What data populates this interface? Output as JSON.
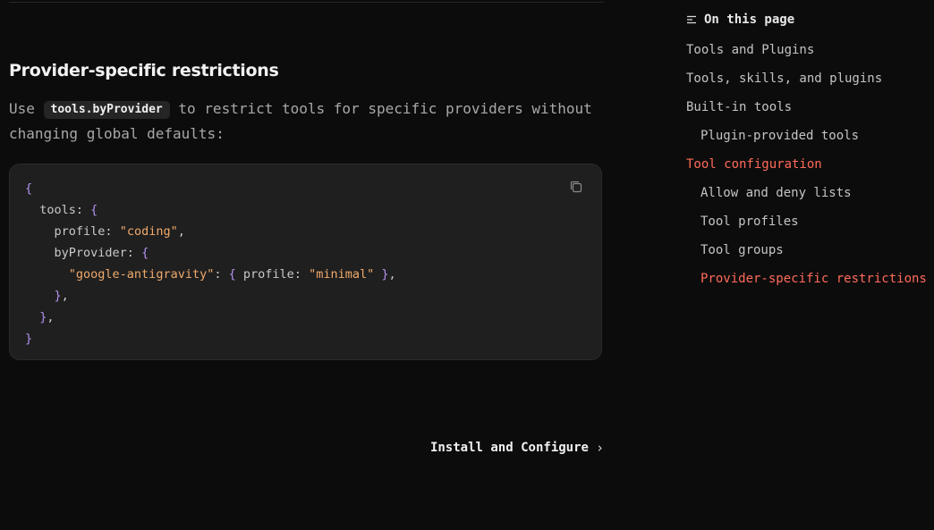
{
  "content": {
    "heading": "Provider-specific restrictions",
    "para_before": "Use ",
    "inline_code": "tools.byProvider",
    "para_after": " to restrict tools for specific providers without changing global defaults:"
  },
  "code_block": {
    "language": "json5",
    "tokens": {
      "open_brace": "{",
      "tools_key": "tools",
      "profile_key": "profile",
      "coding_str": "\"coding\"",
      "byprovider_key": "byProvider",
      "google_str": "\"google-antigravity\"",
      "minimal_str": "\"minimal\"",
      "close_brace": "}"
    },
    "copy_icon": "copy-icon"
  },
  "navigation": {
    "next_label": "Install and Configure",
    "next_icon": "chevron-right-icon"
  },
  "toc": {
    "title": "On this page",
    "items": [
      {
        "label": "Tools and Plugins",
        "level": 1,
        "active": false
      },
      {
        "label": "Tools, skills, and plugins",
        "level": 1,
        "active": false
      },
      {
        "label": "Built-in tools",
        "level": 1,
        "active": false
      },
      {
        "label": "Plugin-provided tools",
        "level": 2,
        "active": false
      },
      {
        "label": "Tool configuration",
        "level": 1,
        "active": true
      },
      {
        "label": "Allow and deny lists",
        "level": 2,
        "active": false
      },
      {
        "label": "Tool profiles",
        "level": 2,
        "active": false
      },
      {
        "label": "Tool groups",
        "level": 2,
        "active": false
      },
      {
        "label": "Provider-specific restrictions",
        "level": 2,
        "active": true
      }
    ]
  },
  "colors": {
    "background": "#0d0c0c",
    "code_background": "#1f1f1f",
    "accent_active": "#ff6b5a",
    "string": "#f0a96b",
    "brace": "#b392f0"
  }
}
